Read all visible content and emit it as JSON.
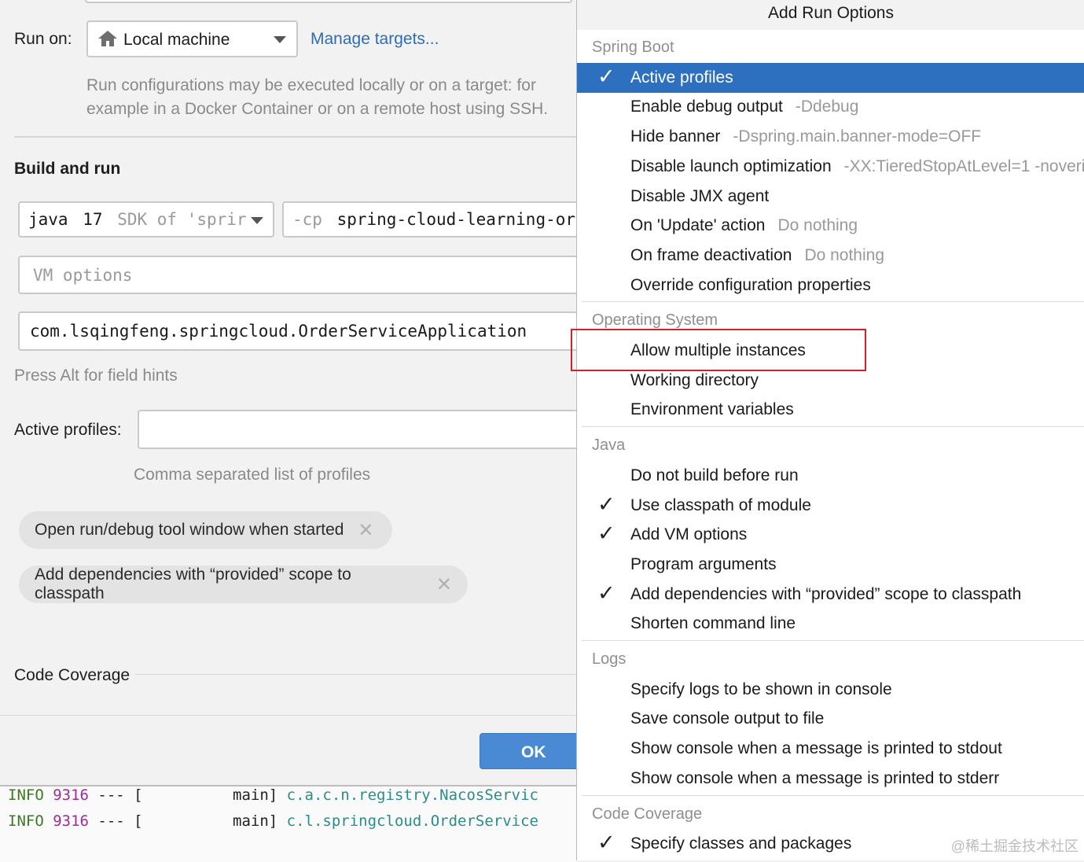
{
  "dialog": {
    "run_on_label": "Run on:",
    "run_on_value": "Local machine",
    "manage_targets": "Manage targets...",
    "run_on_hint_1": "Run configurations may be executed locally or on a target: for",
    "run_on_hint_2": "example in a Docker Container or on a remote host using SSH.",
    "build_and_run": "Build and run",
    "jre_java": "java",
    "jre_version": "17",
    "jre_desc": "SDK of 'sprir",
    "cp_prefix": "-cp",
    "cp_value": "spring-cloud-learning-or",
    "vm_options_placeholder": "VM options",
    "main_class": "com.lsqingfeng.springcloud.OrderServiceApplication",
    "field_hint": "Press Alt for field hints",
    "active_profiles_label": "Active profiles:",
    "active_profiles_value": "",
    "active_profiles_hint": "Comma separated list of profiles",
    "tags": [
      "Open run/debug tool window when started",
      "Add dependencies with “provided” scope to classpath"
    ],
    "code_coverage": "Code Coverage",
    "ok": "OK"
  },
  "console": {
    "lines": [
      {
        "level": "INFO",
        "pid": "9316",
        "sep": " --- [",
        "thread": "main]",
        "cls": "c.a.c.n.registry.NacosServic"
      },
      {
        "level": "INFO",
        "pid": "9316",
        "sep": " --- [",
        "thread": "main]",
        "cls": "c.l.springcloud.OrderService"
      }
    ]
  },
  "popup": {
    "title": "Add Run Options",
    "groups": [
      {
        "name": "Spring Boot",
        "items": [
          {
            "label": "Active profiles",
            "sub": "",
            "checked": true,
            "selected": true
          },
          {
            "label": "Enable debug output",
            "sub": "-Ddebug",
            "checked": false
          },
          {
            "label": "Hide banner",
            "sub": "-Dspring.main.banner-mode=OFF",
            "checked": false
          },
          {
            "label": "Disable launch optimization",
            "sub": "-XX:TieredStopAtLevel=1 -noveri",
            "checked": false
          },
          {
            "label": "Disable JMX agent",
            "sub": "",
            "checked": false
          },
          {
            "label": "On 'Update' action",
            "sub": "Do nothing",
            "checked": false
          },
          {
            "label": "On frame deactivation",
            "sub": "Do nothing",
            "checked": false
          },
          {
            "label": "Override configuration properties",
            "sub": "",
            "checked": false
          }
        ]
      },
      {
        "name": "Operating System",
        "items": [
          {
            "label": "Allow multiple instances",
            "sub": "",
            "checked": false
          },
          {
            "label": "Working directory",
            "sub": "",
            "checked": false
          },
          {
            "label": "Environment variables",
            "sub": "",
            "checked": false
          }
        ]
      },
      {
        "name": "Java",
        "items": [
          {
            "label": "Do not build before run",
            "sub": "",
            "checked": false
          },
          {
            "label": "Use classpath of module",
            "sub": "",
            "checked": true
          },
          {
            "label": "Add VM options",
            "sub": "",
            "checked": true
          },
          {
            "label": "Program arguments",
            "sub": "",
            "checked": false
          },
          {
            "label": "Add dependencies with “provided” scope to classpath",
            "sub": "",
            "checked": true
          },
          {
            "label": "Shorten command line",
            "sub": "",
            "checked": false
          }
        ]
      },
      {
        "name": "Logs",
        "items": [
          {
            "label": "Specify logs to be shown in console",
            "sub": "",
            "checked": false
          },
          {
            "label": "Save console output to file",
            "sub": "",
            "checked": false
          },
          {
            "label": "Show console when a message is printed to stdout",
            "sub": "",
            "checked": false
          },
          {
            "label": "Show console when a message is printed to stderr",
            "sub": "",
            "checked": false
          }
        ]
      },
      {
        "name": "Code Coverage",
        "items": [
          {
            "label": "Specify classes and packages",
            "sub": "",
            "checked": true
          }
        ]
      }
    ]
  },
  "watermark": "@稀土掘金技术社区",
  "colors": {
    "selection": "#2e70c0",
    "link": "#2a6ebb",
    "highlight_box": "#d0202e",
    "ok_button": "#4a8ad4"
  }
}
